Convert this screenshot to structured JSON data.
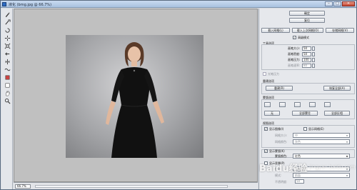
{
  "window": {
    "title": "液化 (bmg.jpg @ 66.7%)",
    "controls": {
      "minimize": "–",
      "maximize": "□",
      "close": "✕"
    }
  },
  "tools": [
    "warp-icon",
    "reconstruct-icon",
    "twirl-icon",
    "pucker-icon",
    "bloat-icon",
    "push-left-icon",
    "mirror-icon",
    "turbulence-icon",
    "freeze-mask-icon",
    "thaw-mask-icon",
    "hand-icon",
    "zoom-icon"
  ],
  "statusbar": {
    "zoom": "66.7%"
  },
  "panel": {
    "ok_label": "确定",
    "reset_label": "复位",
    "load_mesh_label": "载入网格(L)",
    "load_last_mesh_label": "载入上次网格(O)",
    "save_mesh_label": "存储网格(V)",
    "advanced_mode_label": "高级模式",
    "advanced_mode_checked": true,
    "tool_options_title": "工具选项",
    "brush_size_label": "画笔大小:",
    "brush_size_value": "50",
    "brush_density_label": "画笔密度:",
    "brush_density_value": "50",
    "brush_pressure_label": "画笔压力:",
    "brush_pressure_value": "100",
    "brush_rate_label": "画笔速率:",
    "brush_rate_value": "80",
    "stylus_label": "光笔压力",
    "reconstruct_title": "重建选项",
    "reconstruct_button": "重建(R)",
    "restore_all_button": "恢复全部(A)",
    "mask_title": "蒙版选项",
    "none_button": "无",
    "mask_all_button": "全部蒙住",
    "invert_all_button": "全部反相",
    "view_title": "视图选项",
    "show_image_label": "显示图像(I)",
    "show_image_checked": true,
    "show_mesh_label": "显示网格(E)",
    "show_mesh_checked": false,
    "mesh_size_label": "网格大小:",
    "mesh_size_value": "中",
    "mesh_color_label": "网格颜色:",
    "mesh_color_value": "灰色",
    "show_mask_label": "显示蒙版(K)",
    "show_mask_checked": true,
    "mask_color_label": "蒙版颜色:",
    "mask_color_value": "红色",
    "show_backdrop_label": "显示背景(P)",
    "show_backdrop_checked": false,
    "use_label": "使用:",
    "use_value": "所有图层",
    "mode_label": "模式:",
    "mode_value": "前面",
    "opacity_label": "不透明度:",
    "opacity_value": "50"
  },
  "watermark": {
    "main": "Baidu经验",
    "sub": "jingyan.baidu.com"
  },
  "colors": {
    "title_bar": "#b9cfe9",
    "canvas": "#c0c0c0",
    "panel": "#e6e8ec",
    "dress": "#111111"
  }
}
